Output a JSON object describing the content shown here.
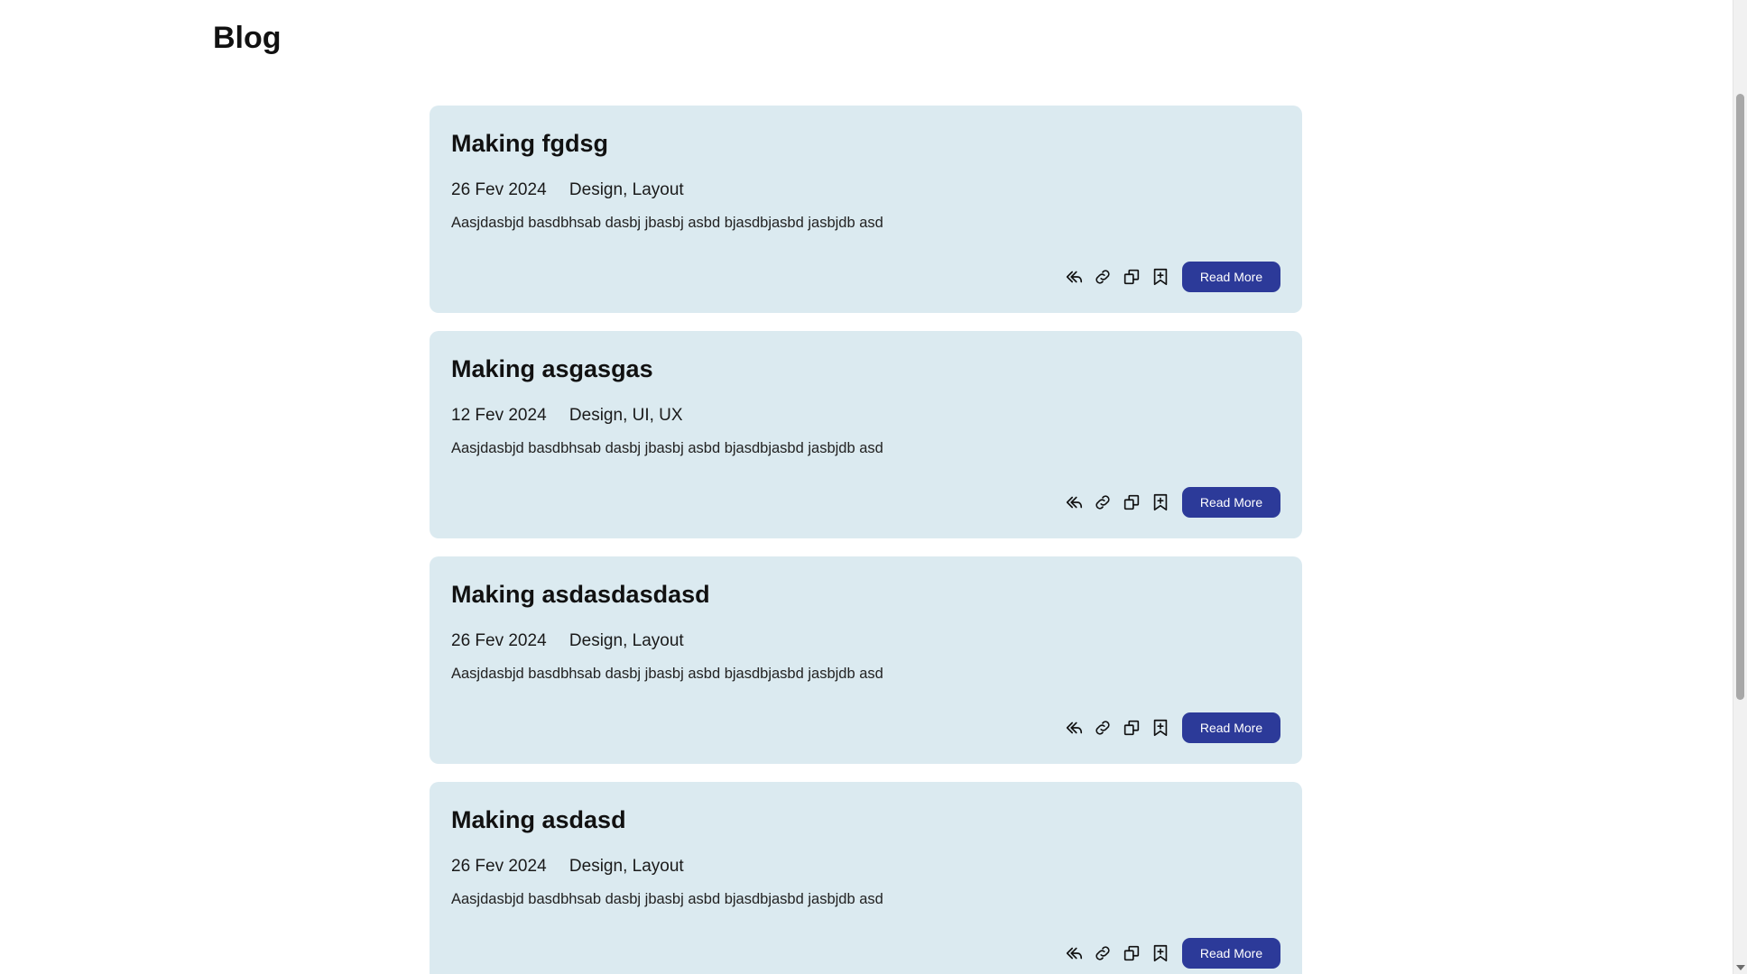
{
  "page": {
    "title": "Blog"
  },
  "posts": [
    {
      "title": "Making fgdsg",
      "date": "26 Fev 2024",
      "tags": "Design, Layout",
      "excerpt": "Aasjdasbjd basdbhsab dasbj jbasbj asbd bjasdbjasbd jasbjdb asd",
      "cta": "Read More"
    },
    {
      "title": "Making asgasgas",
      "date": "12 Fev 2024",
      "tags": "Design, UI, UX",
      "excerpt": "Aasjdasbjd basdbhsab dasbj jbasbj asbd bjasdbjasbd jasbjdb asd",
      "cta": "Read More"
    },
    {
      "title": "Making asdasdasdasd",
      "date": "26 Fev 2024",
      "tags": "Design, Layout",
      "excerpt": "Aasjdasbjd basdbhsab dasbj jbasbj asbd bjasdbjasbd jasbjdb asd",
      "cta": "Read More"
    },
    {
      "title": "Making asdasd",
      "date": "26 Fev 2024",
      "tags": "Design, Layout",
      "excerpt": "Aasjdasbjd basdbhsab dasbj jbasbj asbd bjasdbjasbd jasbjdb asd",
      "cta": "Read More"
    }
  ],
  "icons": {
    "share": "reply-arrow-icon",
    "link": "link-icon",
    "copy": "copy-icon",
    "bookmark": "bookmark-add-icon"
  },
  "colors": {
    "card_background": "#dbeaf0",
    "button_background": "#2c3a99",
    "button_text": "#ffffff"
  }
}
